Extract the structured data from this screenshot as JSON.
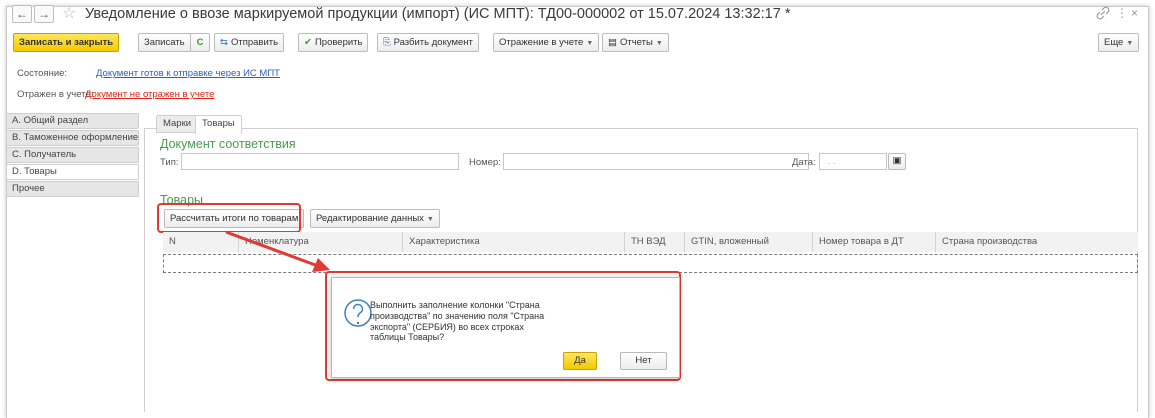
{
  "window": {
    "title": "Уведомление о ввозе маркируемой продукции (импорт) (ИС МПТ): ТД00-000002 от 15.07.2024 13:32:17 *",
    "back_icon": "←",
    "forward_icon": "→",
    "star_icon": "☆",
    "link_icon": "🔗",
    "menu_icon": "⋮",
    "close_icon": "×"
  },
  "toolbar": {
    "save_close": "Записать и закрыть",
    "save": "Записать",
    "refresh_icon": "C",
    "send": "Отправить",
    "check": "Проверить",
    "split": "Разбить документ",
    "accounting": "Отражение в учете",
    "reports": "Отчеты",
    "more": "Еще"
  },
  "status": {
    "state_label": "Состояние:",
    "state_value": "Документ готов к отправке через ИС МПТ",
    "reflected_label": "Отражен в учете:",
    "reflected_value": "Документ не отражен в учете"
  },
  "sidebar": {
    "items": [
      {
        "label": "А. Общий раздел"
      },
      {
        "label": "В. Таможенное оформление"
      },
      {
        "label": "С. Получатель"
      },
      {
        "label": "D. Товары"
      },
      {
        "label": "Прочее"
      }
    ]
  },
  "tabs": [
    {
      "label": "Марки"
    },
    {
      "label": "Товары"
    }
  ],
  "doc_section": {
    "title": "Документ соответствия",
    "type_label": "Тип:",
    "number_label": "Номер:",
    "date_label": "Дата:",
    "date_placeholder": ". ."
  },
  "goods_section": {
    "title": "Товары",
    "calc_button": "Рассчитать итоги по товарам",
    "edit_button": "Редактирование данных"
  },
  "table": {
    "columns": [
      "N",
      "Номенклатура",
      "Характеристика",
      "ТН ВЭД",
      "GTIN, вложенный",
      "Номер товара в ДТ",
      "Страна производства"
    ]
  },
  "dialog": {
    "icon": "?",
    "message": "Выполнить заполнение колонки \"Страна производства\" по значению поля \"Страна экспорта\" (СЕРБИЯ) во всех строках таблицы Товары?",
    "yes": "Да",
    "no": "Нет"
  },
  "colors": {
    "accent_yellow": "#f4c900",
    "group_green": "#4a9a52",
    "link_blue": "#2f5fb3",
    "link_red": "#e0261a",
    "highlight_red": "#e03a33"
  }
}
